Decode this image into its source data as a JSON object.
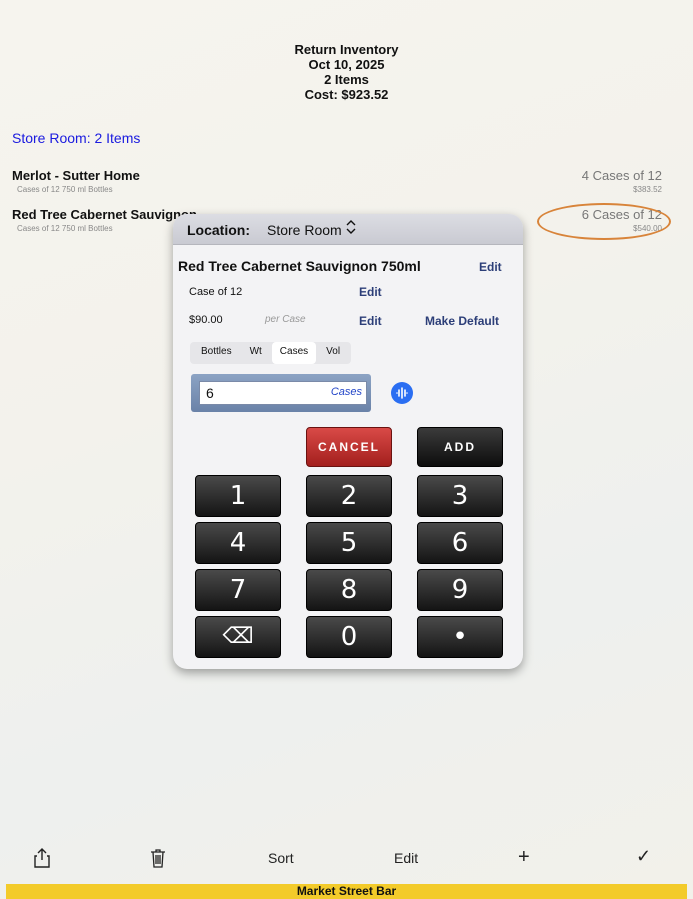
{
  "header": {
    "title": "Return Inventory",
    "date": "Oct 10, 2025",
    "count": "2 Items",
    "cost": "Cost: $923.52"
  },
  "section": {
    "title": "Store Room: 2 Items"
  },
  "items": [
    {
      "name": "Merlot - Sutter Home",
      "sub": "Cases of 12 750 ml Bottles",
      "qty": "4 Cases of 12",
      "cost": "$383.52"
    },
    {
      "name": "Red Tree Cabernet Sauvignon",
      "sub": "Cases of 12 750 ml Bottles",
      "qty": "6 Cases of 12",
      "cost": "$540.00"
    }
  ],
  "popup": {
    "location_label": "Location:",
    "location_value": "Store Room",
    "location_chevron": "⌃⌄",
    "product": "Red Tree Cabernet Sauvignon 750ml",
    "edit": "Edit",
    "case_label": "Case of 12",
    "price": "$90.00",
    "per_case": "per Case",
    "make_default": "Make Default",
    "units": [
      "Bottles",
      "Wt",
      "Cases",
      "Vol"
    ],
    "selected_unit": "Cases",
    "quantity": "6",
    "quantity_unit": "Cases",
    "cancel": "CANCEL",
    "add": "ADD",
    "keys": [
      "1",
      "2",
      "3",
      "4",
      "5",
      "6",
      "7",
      "8",
      "9",
      "⌫",
      "0",
      "•"
    ]
  },
  "toolbar": {
    "sort": "Sort",
    "edit": "Edit",
    "add": "+",
    "done": "✓"
  },
  "footer": {
    "label": "Market Street Bar"
  },
  "colors": {
    "accent": "#1a1adf",
    "footer": "#f3cb2a",
    "cancel": "#c0302e",
    "annotation": "#d8843a"
  }
}
